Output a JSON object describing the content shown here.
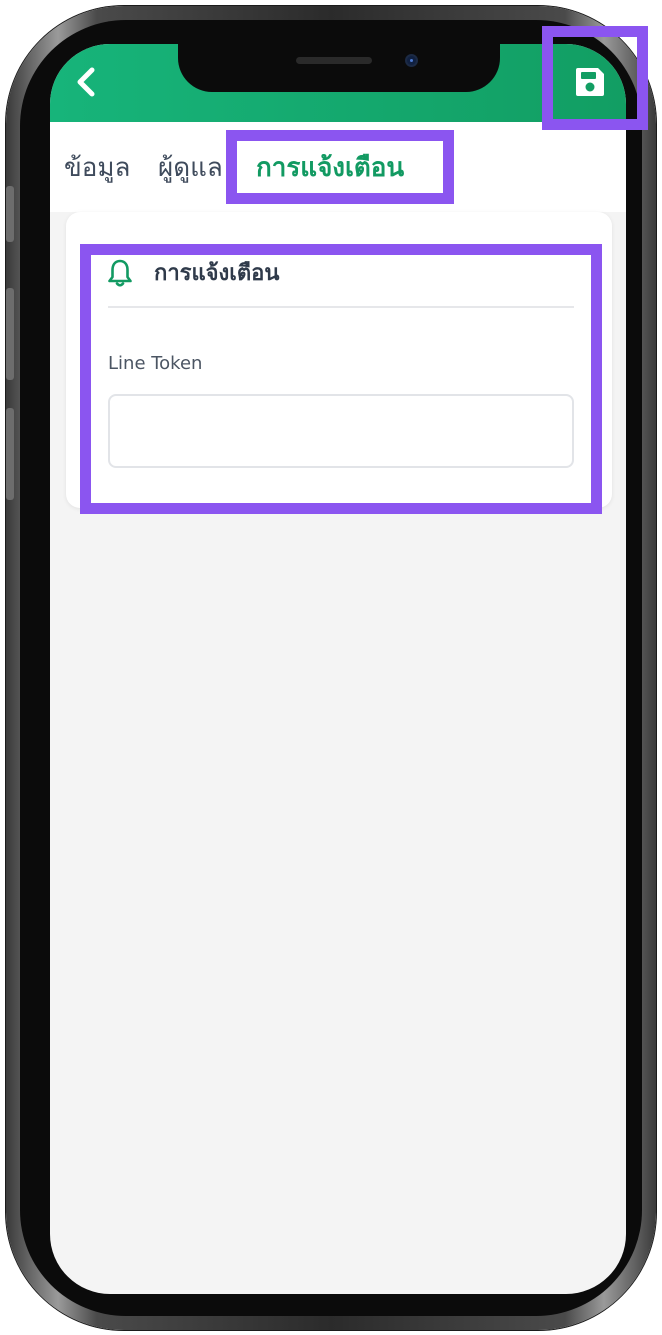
{
  "header": {
    "back_icon": "chevron-left-icon",
    "save_icon": "floppy-disk-icon",
    "color_start": "#17b47a",
    "color_end": "#129e63"
  },
  "tabs": [
    {
      "label": "ข้อมูล",
      "active": false
    },
    {
      "label": "ผู้ดูแล",
      "active": false
    },
    {
      "label": "การแจ้งเตือน",
      "active": true
    }
  ],
  "notification_card": {
    "title": "การแจ้งเตือน",
    "icon": "bell-icon",
    "field_label": "Line Token",
    "field_value": "",
    "field_placeholder": ""
  },
  "colors": {
    "accent": "#129a62",
    "highlight": "#8b55f0",
    "background": "#f4f4f4"
  }
}
